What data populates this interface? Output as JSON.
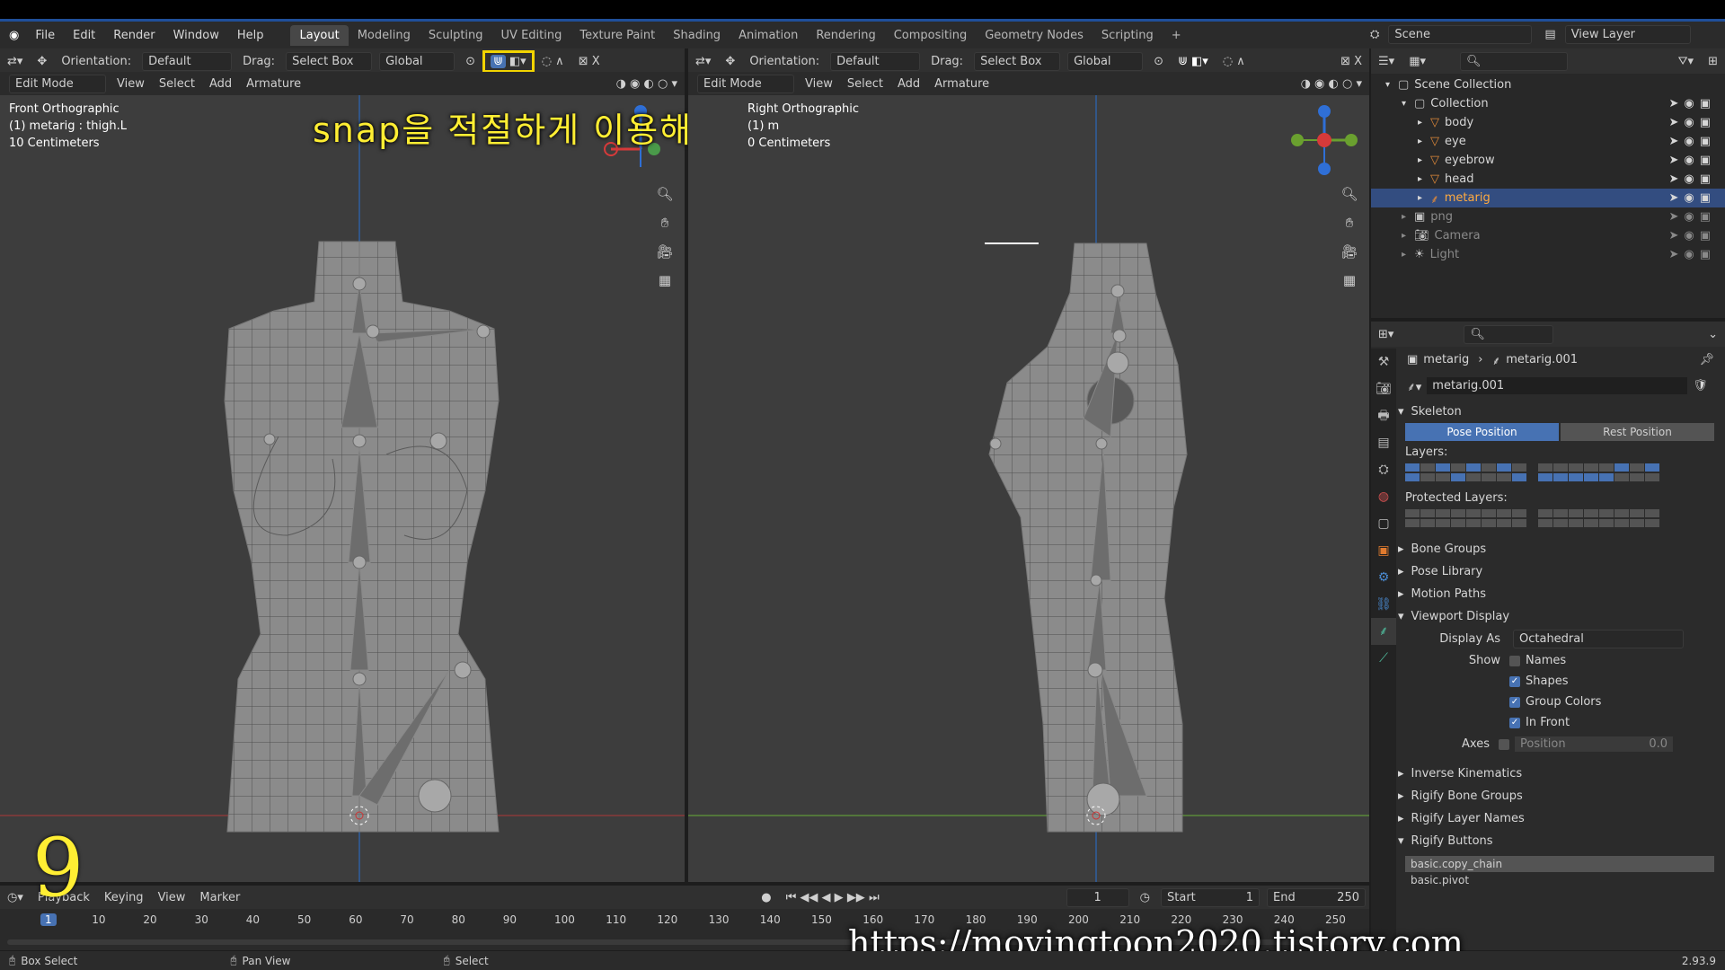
{
  "menu": {
    "items": [
      "File",
      "Edit",
      "Render",
      "Window",
      "Help"
    ]
  },
  "workspaces": [
    "Layout",
    "Modeling",
    "Sculpting",
    "UV Editing",
    "Texture Paint",
    "Shading",
    "Animation",
    "Rendering",
    "Compositing",
    "Geometry Nodes",
    "Scripting",
    "+"
  ],
  "scene": {
    "scene_label": "Scene",
    "view_layer_label": "View Layer"
  },
  "left_viewport": {
    "header": {
      "orientation_label": "Orientation:",
      "orientation_value": "Default",
      "drag_label": "Drag:",
      "drag_value": "Select Box",
      "transform_value": "Global"
    },
    "header2": {
      "mode": "Edit Mode",
      "menus": [
        "View",
        "Select",
        "Add",
        "Armature"
      ]
    },
    "overlay_lines": [
      "Front Orthographic",
      "(1) metarig : thigh.L",
      "10 Centimeters"
    ]
  },
  "right_viewport": {
    "header": {
      "orientation_label": "Orientation:",
      "orientation_value": "Default",
      "drag_label": "Drag:",
      "drag_value": "Select Box",
      "transform_value": "Global"
    },
    "header2": {
      "mode": "Edit Mode",
      "menus": [
        "View",
        "Select",
        "Add",
        "Armature"
      ]
    },
    "overlay_lines": [
      "Right Orthographic",
      "(1) m",
      "0 Centimeters"
    ]
  },
  "caption": {
    "korean": "snap을 적절하게 이용해서 bone 위치 시킴",
    "step_number": "9",
    "url": "https://movingtoon2020.tistory.com"
  },
  "colors": {
    "accent": "#4772b3",
    "highlight_box": "#f2d400",
    "caption": "#ffee33"
  },
  "outliner": {
    "search_placeholder": "",
    "rows": [
      {
        "label": "Scene Collection",
        "indent": 0,
        "icon": "collection-icon"
      },
      {
        "label": "Collection",
        "indent": 1,
        "icon": "collection-icon"
      },
      {
        "label": "body",
        "indent": 2,
        "icon": "mesh-icon"
      },
      {
        "label": "eye",
        "indent": 2,
        "icon": "mesh-icon"
      },
      {
        "label": "eyebrow",
        "indent": 2,
        "icon": "mesh-icon"
      },
      {
        "label": "head",
        "indent": 2,
        "icon": "mesh-icon"
      },
      {
        "label": "metarig",
        "indent": 2,
        "icon": "armature-icon",
        "selected": true
      },
      {
        "label": "png",
        "indent": 1,
        "icon": "image-icon",
        "dim": true
      },
      {
        "label": "Camera",
        "indent": 1,
        "icon": "camera-icon",
        "dim": true
      },
      {
        "label": "Light",
        "indent": 1,
        "icon": "light-icon",
        "dim": true
      }
    ]
  },
  "properties": {
    "breadcrumb_obj": "metarig",
    "breadcrumb_data": "metarig.001",
    "datablock": "metarig.001",
    "skeleton_title": "Skeleton",
    "pose_position": "Pose Position",
    "rest_position": "Rest Position",
    "layers_label": "Layers:",
    "protected_layers_label": "Protected Layers:",
    "sections_collapsed": [
      "Bone Groups",
      "Pose Library",
      "Motion Paths"
    ],
    "viewport_display": "Viewport Display",
    "display_as_label": "Display As",
    "display_as_value": "Octahedral",
    "show_label": "Show",
    "show_options": [
      {
        "label": "Names",
        "checked": false
      },
      {
        "label": "Shapes",
        "checked": true
      },
      {
        "label": "Group Colors",
        "checked": true
      },
      {
        "label": "In Front",
        "checked": true
      }
    ],
    "axes_label": "Axes",
    "axes_position_label": "Position",
    "axes_position_value": "0.0",
    "sections_after": [
      "Inverse Kinematics",
      "Rigify Bone Groups",
      "Rigify Layer Names"
    ],
    "rigify_buttons": "Rigify Buttons",
    "rigify_list": [
      "basic.copy_chain",
      "basic.pivot"
    ]
  },
  "timeline": {
    "menus": [
      "Playback",
      "Keying",
      "View",
      "Marker"
    ],
    "current_frame": "1",
    "start_label": "Start",
    "start_value": "1",
    "end_label": "End",
    "end_value": "250",
    "ticks": [
      "1",
      "10",
      "20",
      "30",
      "40",
      "50",
      "60",
      "70",
      "80",
      "90",
      "100",
      "110",
      "120",
      "130",
      "140",
      "150",
      "160",
      "170",
      "180",
      "190",
      "200",
      "210",
      "220",
      "230",
      "240",
      "250"
    ]
  },
  "status": {
    "box_select": "Box Select",
    "pan_view": "Pan View",
    "select": "Select",
    "version": "2.93.9"
  }
}
